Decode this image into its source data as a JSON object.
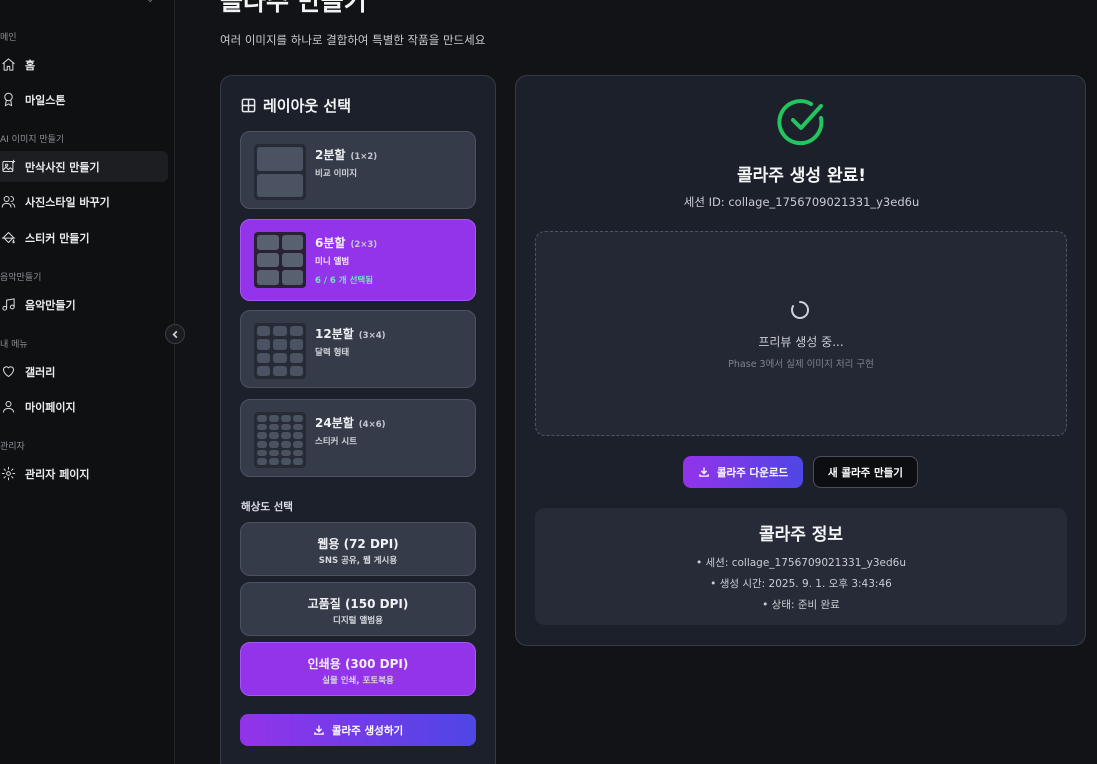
{
  "sidebar": {
    "sections": [
      {
        "title": "메인",
        "items": [
          {
            "label": "홈",
            "icon": "home-icon"
          },
          {
            "label": "마일스톤",
            "icon": "award-icon"
          }
        ]
      },
      {
        "title": "AI 이미지 만들기",
        "items": [
          {
            "label": "만삭사진 만들기",
            "icon": "image-sparkle-icon",
            "active": true
          },
          {
            "label": "사진스타일 바꾸기",
            "icon": "users-icon"
          },
          {
            "label": "스티커 만들기",
            "icon": "paint-bucket-icon"
          }
        ]
      },
      {
        "title": "음악만들기",
        "items": [
          {
            "label": "음악만들기",
            "icon": "music-icon"
          }
        ]
      },
      {
        "title": "내 메뉴",
        "items": [
          {
            "label": "갤러리",
            "icon": "heart-icon"
          },
          {
            "label": "마이페이지",
            "icon": "user-icon"
          }
        ]
      },
      {
        "title": "관리자",
        "items": [
          {
            "label": "관리자 페이지",
            "icon": "gear-icon"
          }
        ]
      }
    ]
  },
  "header": {
    "title": "콜라주 만들기",
    "subtitle": "여러 이미지를 하나로 결합하여 특별한 작품을 만드세요"
  },
  "layout_panel": {
    "title": "레이아웃 선택",
    "layouts": [
      {
        "name": "2분할",
        "grid": "(1×2)",
        "desc": "비교 이미지",
        "selected": false
      },
      {
        "name": "6분할",
        "grid": "(2×3)",
        "desc": "미니 앨범",
        "count": "6 / 6 개 선택됨",
        "selected": true
      },
      {
        "name": "12분할",
        "grid": "(3×4)",
        "desc": "달력 형태",
        "selected": false
      },
      {
        "name": "24분할",
        "grid": "(4×6)",
        "desc": "스티커 시트",
        "selected": false
      }
    ],
    "resolution_title": "해상도 선택",
    "resolutions": [
      {
        "main": "웹용 (72 DPI)",
        "sub": "SNS 공유, 웹 게시용",
        "selected": false
      },
      {
        "main": "고품질 (150 DPI)",
        "sub": "디지털 앨범용",
        "selected": false
      },
      {
        "main": "인쇄용 (300 DPI)",
        "sub": "실물 인쇄, 포토북용",
        "selected": true
      }
    ],
    "generate_label": "콜라주 생성하기"
  },
  "result_panel": {
    "done_title": "콜라주 생성 완료!",
    "session_id": "세션 ID: collage_1756709021331_y3ed6u",
    "preview_main": "프리뷰 생성 중...",
    "preview_sub": "Phase 3에서 실제 이미지 처리 구현",
    "download_label": "콜라주 다운로드",
    "new_label": "새 콜라주 만들기",
    "info_title": "콜라주 정보",
    "info_lines": [
      "• 세션: collage_1756709021331_y3ed6u",
      "• 생성 시간: 2025. 9. 1. 오후 3:43:46",
      "• 상태: 준비 완료"
    ]
  },
  "colors": {
    "accent": "#9333ea",
    "accent_end": "#4f46e5",
    "success": "#22c55e",
    "count_text": "#6ee7b7"
  }
}
